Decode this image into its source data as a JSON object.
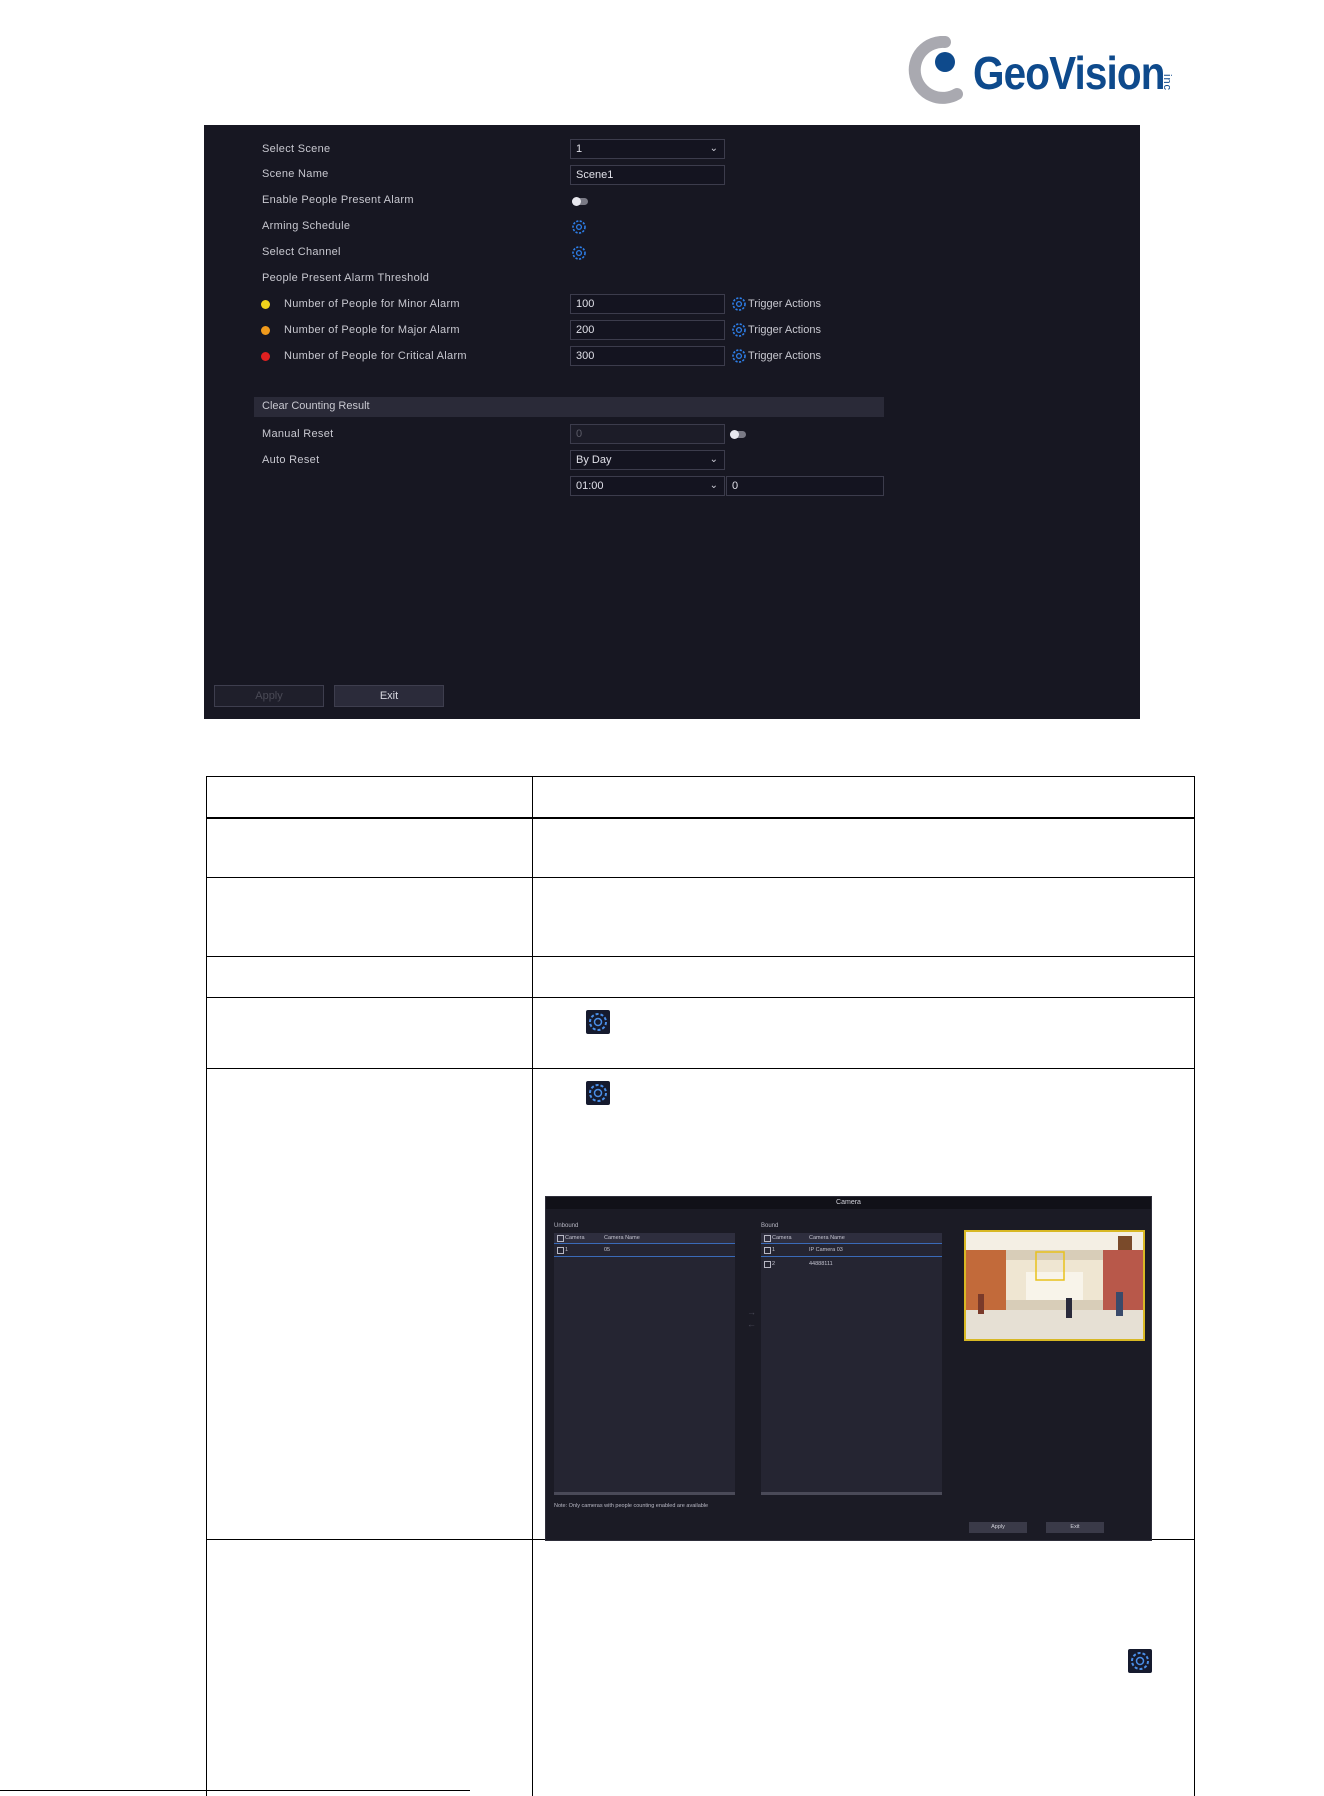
{
  "brand": {
    "name": "GeoVision",
    "suffix": "inc"
  },
  "settings": {
    "select_scene": {
      "label": "Select Scene",
      "value": "1"
    },
    "scene_name": {
      "label": "Scene Name",
      "value": "Scene1"
    },
    "enable_alarm": {
      "label": "Enable People Present Alarm"
    },
    "arming_schedule": {
      "label": "Arming Schedule"
    },
    "select_channel": {
      "label": "Select Channel"
    },
    "threshold_heading": "People Present Alarm Threshold",
    "minor": {
      "label": "Number of People for Minor Alarm",
      "value": "100",
      "action": "Trigger Actions",
      "color": "#f0d21c"
    },
    "major": {
      "label": "Number of People for Major Alarm",
      "value": "200",
      "action": "Trigger Actions",
      "color": "#f09a1c"
    },
    "critical": {
      "label": "Number of People for Critical Alarm",
      "value": "300",
      "action": "Trigger Actions",
      "color": "#e02020"
    },
    "clear_section": "Clear Counting Result",
    "manual_reset": {
      "label": "Manual Reset",
      "value": "0"
    },
    "auto_reset": {
      "label": "Auto Reset",
      "value": "By Day",
      "time": "01:00",
      "extra": "0"
    },
    "apply_label": "Apply",
    "exit_label": "Exit"
  },
  "camera_dialog": {
    "title": "Camera",
    "unbound": {
      "heading": "Unbound",
      "col_camera": "Camera",
      "col_name": "Camera Name",
      "rows": [
        {
          "id": "1",
          "name": "05"
        }
      ]
    },
    "bound": {
      "heading": "Bound",
      "col_camera": "Camera",
      "col_name": "Camera Name",
      "rows": [
        {
          "id": "1",
          "name": "IP Camera 03"
        },
        {
          "id": "2",
          "name": "44888111"
        }
      ]
    },
    "note": "Note: Only cameras with people counting enabled are available",
    "apply_label": "Apply",
    "exit_label": "Exit"
  }
}
